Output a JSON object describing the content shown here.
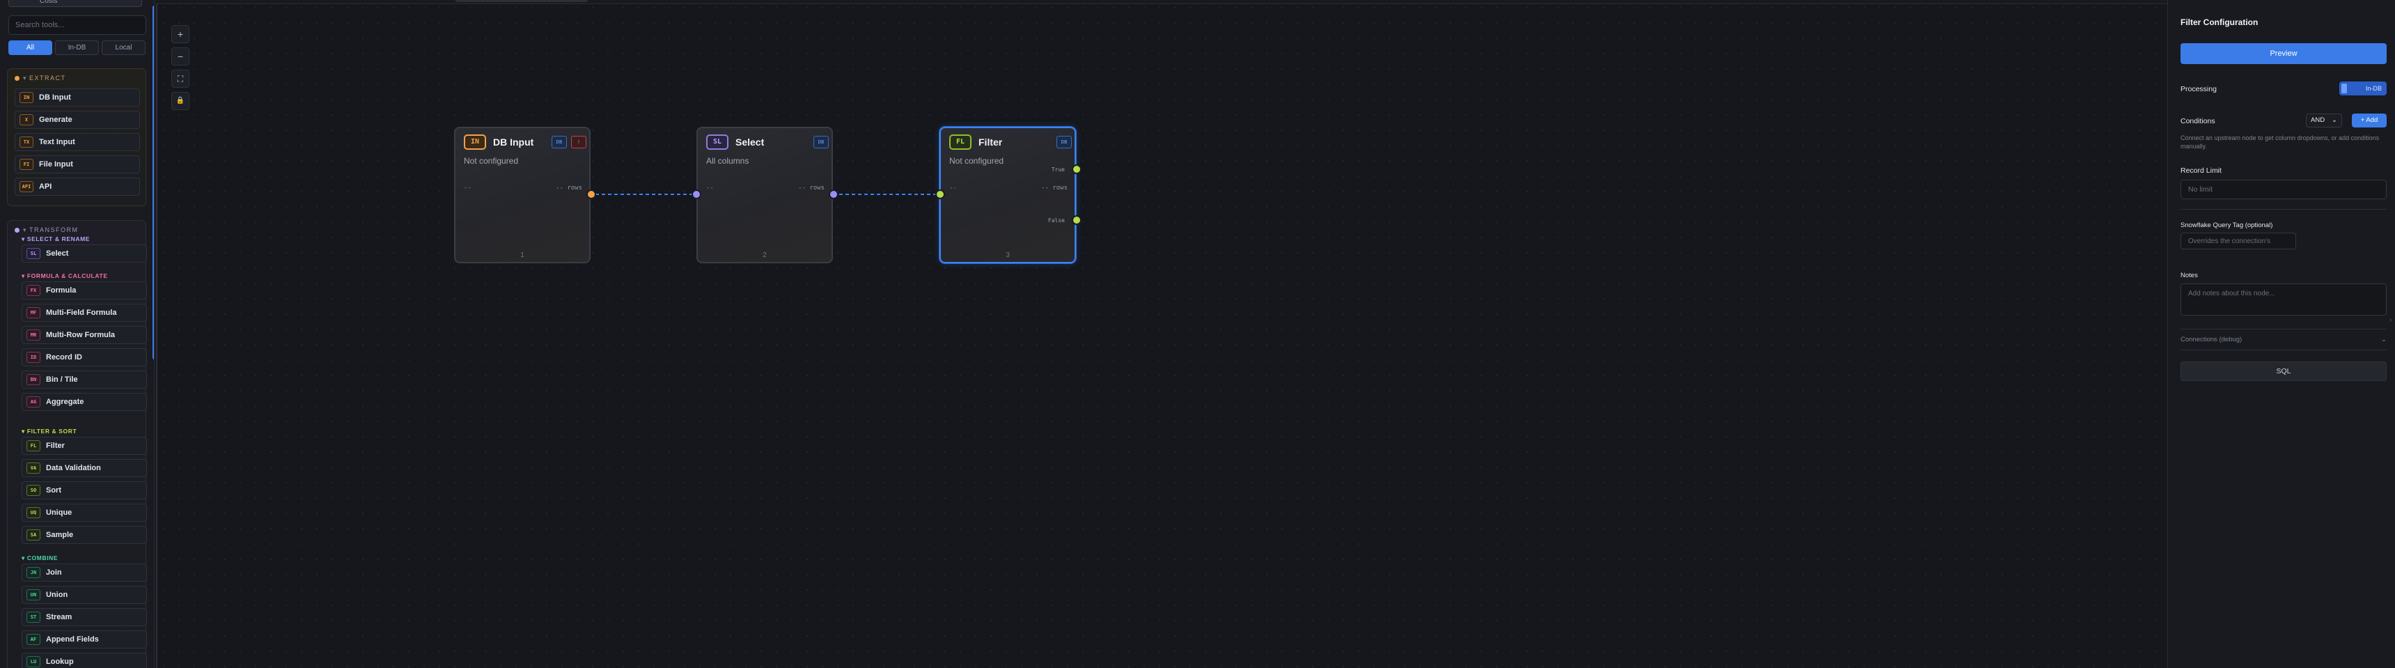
{
  "sidebar": {
    "top_stub_text": "Costs",
    "search_placeholder": "Search tools...",
    "filters": [
      "All",
      "In-DB",
      "Local"
    ],
    "extract": {
      "title": "EXTRACT",
      "dot_color": "#f2a24a",
      "tools": [
        {
          "badge": "IN",
          "label": "DB Input"
        },
        {
          "badge": "X",
          "label": "Generate"
        },
        {
          "badge": "TX",
          "label": "Text Input"
        },
        {
          "badge": "FI",
          "label": "File Input"
        },
        {
          "badge": "API",
          "label": "API"
        }
      ]
    },
    "transform": {
      "title": "TRANSFORM",
      "dot_color": "#b6a4f7",
      "groups": [
        {
          "title": "SELECT & RENAME",
          "color": "#b6a4f7",
          "tools": [
            {
              "badge": "SL",
              "label": "Select"
            }
          ]
        },
        {
          "title": "FORMULA & CALCULATE",
          "color": "#f173a6",
          "tools": [
            {
              "badge": "FX",
              "label": "Formula"
            },
            {
              "badge": "MF",
              "label": "Multi-Field Formula"
            },
            {
              "badge": "MR",
              "label": "Multi-Row Formula"
            },
            {
              "badge": "ID",
              "label": "Record ID"
            },
            {
              "badge": "BN",
              "label": "Bin / Tile"
            },
            {
              "badge": "AG",
              "label": "Aggregate"
            }
          ]
        },
        {
          "title": "FILTER & SORT",
          "color": "#b6dd4a",
          "tools": [
            {
              "badge": "FL",
              "label": "Filter"
            },
            {
              "badge": "VA",
              "label": "Data Validation"
            },
            {
              "badge": "SO",
              "label": "Sort"
            },
            {
              "badge": "UQ",
              "label": "Unique"
            },
            {
              "badge": "SA",
              "label": "Sample"
            }
          ]
        },
        {
          "title": "COMBINE",
          "color": "#4fd6a6",
          "tools": [
            {
              "badge": "JN",
              "label": "Join"
            },
            {
              "badge": "UN",
              "label": "Union"
            },
            {
              "badge": "ST",
              "label": "Stream"
            },
            {
              "badge": "AF",
              "label": "Append Fields"
            },
            {
              "badge": "LU",
              "label": "Lookup"
            }
          ]
        }
      ]
    }
  },
  "canvas": {
    "zoom_controls": [
      "+",
      "−",
      "⛶",
      "🔒"
    ],
    "nodes": [
      {
        "badge": "IN",
        "title": "DB Input",
        "mini": [
          "DB",
          "!"
        ],
        "subtitle": "Not configured",
        "dash": "--",
        "rows": "-- rows",
        "number": "1",
        "accent": "#f2a24a"
      },
      {
        "badge": "SL",
        "title": "Select",
        "mini": [
          "DB"
        ],
        "subtitle": "All columns",
        "dash": "--",
        "rows": "-- rows",
        "number": "2",
        "accent": "#b6a4f7"
      },
      {
        "badge": "FL",
        "title": "Filter",
        "mini": [
          "DB"
        ],
        "subtitle": "Not configured",
        "dash": "--",
        "rows": "-- rows",
        "number": "3",
        "accent": "#b6dd4a",
        "ports": [
          "True",
          "False"
        ],
        "selected": true
      }
    ]
  },
  "panel": {
    "title": "Filter Configuration",
    "preview_label": "Preview",
    "processing_label": "Processing",
    "processing_value": "In-DB",
    "conditions_label": "Conditions",
    "logic_value": "AND",
    "add_label": "+ Add",
    "conditions_help": "Connect an upstream node to get column dropdowns, or add conditions manually.",
    "record_limit_label": "Record Limit",
    "record_limit_placeholder": "No limit",
    "snowflake_label": "Snowflake Query Tag (optional)",
    "snowflake_placeholder": "Overrides the connection's",
    "notes_label": "Notes",
    "notes_placeholder": "Add notes about this node...",
    "connections_label": "Connections (debug)",
    "sql_label": "SQL"
  }
}
